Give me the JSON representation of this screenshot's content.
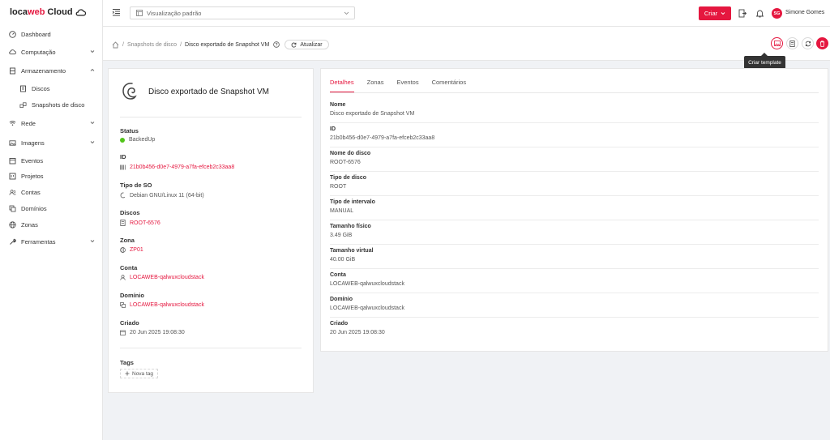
{
  "brand": {
    "loca": "loca",
    "web": "web",
    "cloud": "Cloud"
  },
  "sidebar": {
    "items": [
      {
        "label": "Dashboard",
        "icon": "dashboard-icon"
      },
      {
        "label": "Computação",
        "icon": "cloud-icon"
      },
      {
        "label": "Armazenamento",
        "icon": "database-icon"
      },
      {
        "label": "Discos",
        "icon": "hdd-icon"
      },
      {
        "label": "Snapshots de disco",
        "icon": "snapshot-icon"
      },
      {
        "label": "Rede",
        "icon": "wifi-icon"
      },
      {
        "label": "Imagens",
        "icon": "picture-icon"
      },
      {
        "label": "Eventos",
        "icon": "schedule-icon"
      },
      {
        "label": "Projetos",
        "icon": "project-icon"
      },
      {
        "label": "Contas",
        "icon": "team-icon"
      },
      {
        "label": "Domínios",
        "icon": "block-icon"
      },
      {
        "label": "Zonas",
        "icon": "global-icon"
      },
      {
        "label": "Ferramentas",
        "icon": "tool-icon"
      }
    ]
  },
  "topbar": {
    "view": "Visualização padrão",
    "create": "Criar",
    "user_initials": "SG",
    "user_name": "Simone Gomes"
  },
  "breadcrumb": {
    "parent": "Snapshots de disco",
    "current": "Disco exportado de Snapshot VM",
    "refresh": "Atualizar"
  },
  "tooltip": "Criar template",
  "left": {
    "title": "Disco exportado de Snapshot VM",
    "fields": [
      {
        "label": "Status",
        "value": "BackedUp"
      },
      {
        "label": "ID",
        "value": "21b0b456-d0e7-4979-a7fa-efceb2c33aa8"
      },
      {
        "label": "Tipo de SO",
        "value": "Debian GNU/Linux 11 (64-bit)"
      },
      {
        "label": "Discos",
        "value": "ROOT-6576"
      },
      {
        "label": "Zona",
        "value": "ZP01"
      },
      {
        "label": "Conta",
        "value": "LOCAWEB-qalwuxcloudstack"
      },
      {
        "label": "Domínio",
        "value": "LOCAWEB-qalwuxcloudstack"
      },
      {
        "label": "Criado",
        "value": "20 Jun 2025 19:08:30"
      }
    ],
    "tags_label": "Tags",
    "new_tag": "Nova tag"
  },
  "right": {
    "tabs": [
      "Detalhes",
      "Zonas",
      "Eventos",
      "Comentários"
    ],
    "details": [
      {
        "label": "Nome",
        "value": "Disco exportado de Snapshot VM"
      },
      {
        "label": "ID",
        "value": "21b0b456-d0e7-4979-a7fa-efceb2c33aa8"
      },
      {
        "label": "Nome do disco",
        "value": "ROOT-6576"
      },
      {
        "label": "Tipo de disco",
        "value": "ROOT"
      },
      {
        "label": "Tipo de intervalo",
        "value": "MANUAL"
      },
      {
        "label": "Tamanho físico",
        "value": "3.49 GiB"
      },
      {
        "label": "Tamanho virtual",
        "value": "40.00 GiB"
      },
      {
        "label": "Conta",
        "value": "LOCAWEB-qalwuxcloudstack"
      },
      {
        "label": "Domínio",
        "value": "LOCAWEB-qalwuxcloudstack"
      },
      {
        "label": "Criado",
        "value": "20 Jun 2025 19:08:30"
      }
    ]
  },
  "colors": {
    "accent": "#e5173f",
    "status_ok": "#52c41a"
  }
}
